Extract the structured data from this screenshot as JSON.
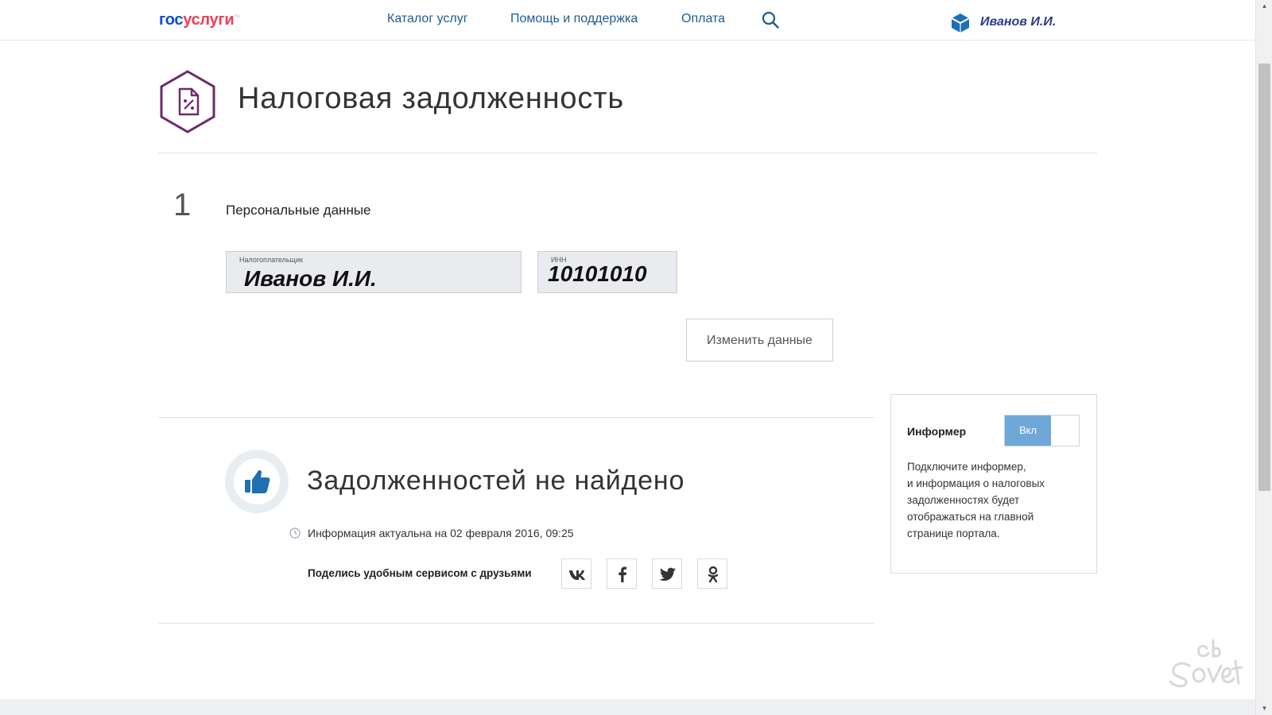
{
  "header": {
    "logo_gos": "гос",
    "logo_uslugi": "услуги",
    "logo_mark": "ru",
    "nav": [
      "Каталог услуг",
      "Помощь и поддержка",
      "Оплата"
    ],
    "user_name": "Иванов И.И."
  },
  "page": {
    "title": "Налоговая задолженность",
    "icon": "tax-document-icon"
  },
  "step": {
    "number": "1",
    "title": "Персональные данные"
  },
  "fields": {
    "taxpayer_label": "Налогоплательщик",
    "taxpayer_value": "Иванов И.И.",
    "inn_label": "ИНН",
    "inn_value": "10101010"
  },
  "buttons": {
    "change_data": "Изменить данные"
  },
  "result": {
    "title": "Задолженностей не найдено",
    "info_time": "Информация актуальна на 02 февраля 2016, 09:25",
    "share_text": "Поделись удобным сервисом с друзьями",
    "social": [
      "vk-icon",
      "facebook-icon",
      "twitter-icon",
      "odnoklassniki-icon"
    ]
  },
  "informer": {
    "label": "Информер",
    "toggle_on": "Вкл",
    "text_lines": [
      "Подключите информер,",
      "и информация о налоговых",
      "задолженностях будет",
      "отображаться на главной",
      "странице портала."
    ]
  },
  "colors": {
    "link": "#1e5c93",
    "logo_blue": "#0d4cd3",
    "logo_red": "#ee3f58",
    "icon_purple": "#6b2b6e",
    "like_blue": "#1f6fb5",
    "toggle_on": "#6fa8d8"
  }
}
